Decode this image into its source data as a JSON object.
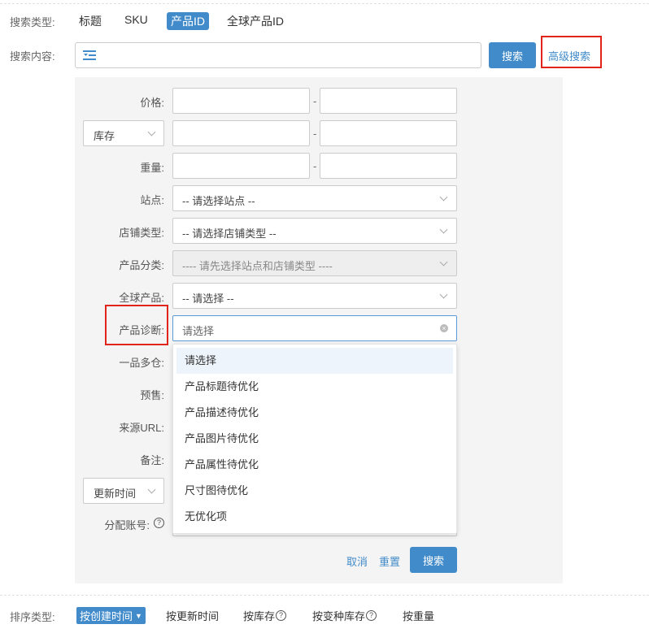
{
  "search_type": {
    "label": "搜索类型:",
    "options": [
      "标题",
      "SKU",
      "产品ID",
      "全球产品ID"
    ],
    "selected": "产品ID"
  },
  "search_content": {
    "label": "搜索内容:",
    "input_value": "",
    "search_button": "搜索",
    "advanced_link": "高级搜索"
  },
  "filters": {
    "price_label": "价格:",
    "stock_select": "库存",
    "weight_label": "重量:",
    "range_sep": "-",
    "site_label": "站点:",
    "site_value": "-- 请选择站点 --",
    "shop_type_label": "店铺类型:",
    "shop_type_value": "-- 请选择店铺类型 --",
    "category_label": "产品分类:",
    "category_value": "---- 请先选择站点和店铺类型 ----",
    "global_product_label": "全球产品:",
    "global_product_value": "-- 请选择 --",
    "diagnosis_label": "产品诊断:",
    "diagnosis_placeholder": "请选择",
    "multi_warehouse_label": "一品多仓:",
    "presale_label": "预售:",
    "source_url_label": "来源URL:",
    "remark_label": "备注:",
    "update_time_select": "更新时间",
    "assign_account_label": "分配账号:",
    "cancel": "取消",
    "reset": "重置",
    "search": "搜索"
  },
  "diagnosis_dropdown": {
    "items": [
      "请选择",
      "产品标题待优化",
      "产品描述待优化",
      "产品图片待优化",
      "产品属性待优化",
      "尺寸图待优化",
      "无优化项"
    ],
    "highlighted": "请选择"
  },
  "sort": {
    "label": "排序类型:",
    "options": [
      "按创建时间",
      "按更新时间",
      "按库存",
      "按变种库存",
      "按重量"
    ],
    "selected": "按创建时间"
  },
  "colors": {
    "primary": "#428bca",
    "highlight_border": "#e1251b",
    "panel_bg": "#f4f4f4"
  }
}
